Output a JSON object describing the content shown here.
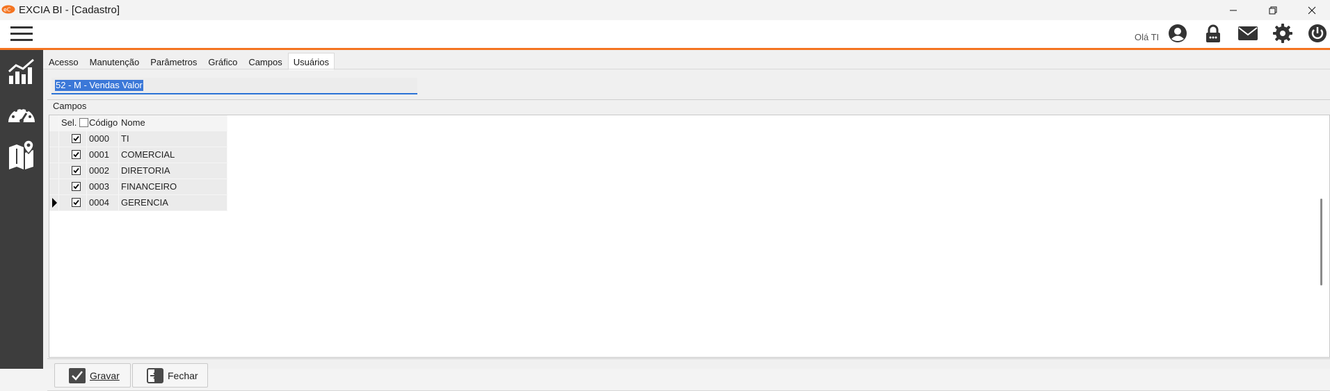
{
  "window": {
    "title": "EXCIA BI - [Cadastro]",
    "controls": [
      "minimize-icon",
      "restore-icon",
      "close-icon"
    ]
  },
  "topbar": {
    "greeting": "Olá TI",
    "icons": [
      "user-icon",
      "lock-icon",
      "mail-icon",
      "gear-icon",
      "power-icon"
    ],
    "accent_color": "#f47421"
  },
  "sidebar": {
    "items": [
      "analytics-icon",
      "dashboard-gauge-icon",
      "map-icon"
    ]
  },
  "tabs": [
    {
      "label": "Acesso"
    },
    {
      "label": "Manutenção"
    },
    {
      "label": "Parâmetros"
    },
    {
      "label": "Gráfico"
    },
    {
      "label": "Campos"
    },
    {
      "label": "Usuários",
      "active": true
    }
  ],
  "name_field": {
    "value": "52 - M - Vendas Valor"
  },
  "section": {
    "label": "Campos"
  },
  "grid": {
    "columns": {
      "sel": "Sel.",
      "code": "Código",
      "name": "Nome"
    },
    "rows": [
      {
        "checked": true,
        "code": "0000",
        "name": "TI"
      },
      {
        "checked": true,
        "code": "0001",
        "name": "COMERCIAL"
      },
      {
        "checked": true,
        "code": "0002",
        "name": "DIRETORIA"
      },
      {
        "checked": true,
        "code": "0003",
        "name": "FINANCEIRO"
      },
      {
        "checked": true,
        "code": "0004",
        "name": "GERENCIA",
        "current": true
      }
    ]
  },
  "buttons": {
    "save": "Gravar",
    "close": "Fechar"
  }
}
